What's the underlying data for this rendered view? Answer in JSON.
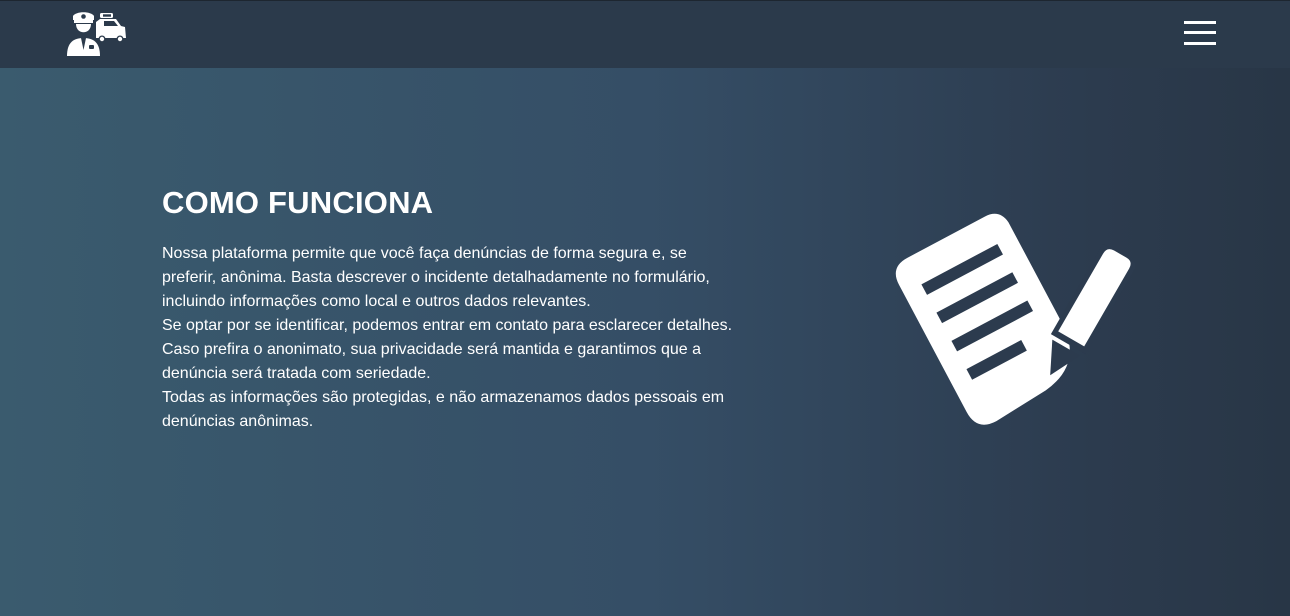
{
  "header": {
    "logo_icon": "police-officer-car-icon",
    "menu_icon": "hamburger-menu-icon"
  },
  "hero": {
    "title": "COMO FUNCIONA",
    "paragraphs": [
      "Nossa plataforma permite que você faça denúncias de forma segura e, se preferir, anônima. Basta descrever o incidente detalhadamente no formulário, incluindo informações como local e outros dados relevantes.",
      "Se optar por se identificar, podemos entrar em contato para esclarecer detalhes. Caso prefira o anonimato, sua privacidade será mantida e garantimos que a denúncia será tratada com seriedade.",
      "Todas as informações são protegidas, e não armazenamos dados pessoais em denúncias anônimas."
    ],
    "illustration_icon": "document-pencil-icon"
  },
  "colors": {
    "topbar": "#2b3a4b",
    "hero_gradient_start": "#3a5b6e",
    "hero_gradient_end": "#283646",
    "text": "#ffffff"
  }
}
